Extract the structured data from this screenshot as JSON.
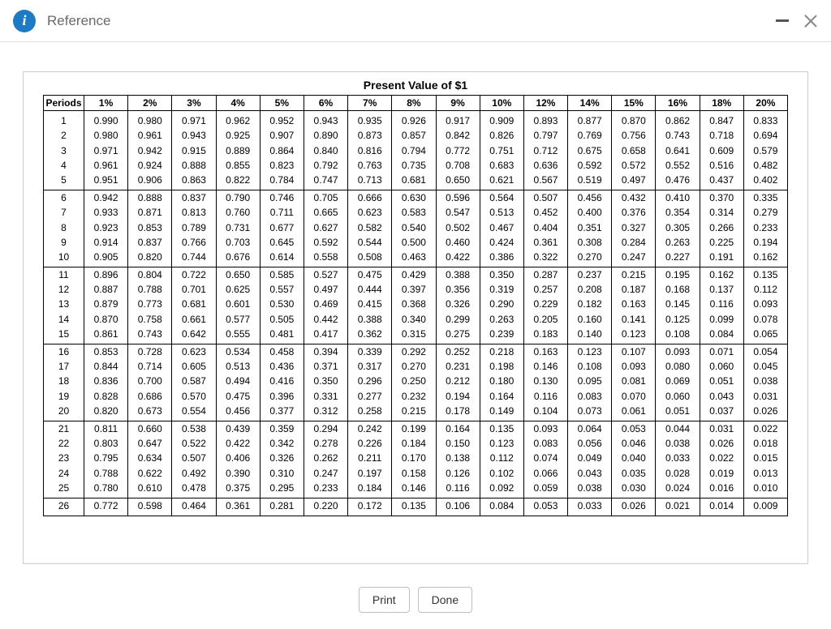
{
  "window": {
    "title": "Reference"
  },
  "buttons": {
    "print": "Print",
    "done": "Done"
  },
  "chart_data": {
    "type": "table",
    "title": "Present Value of $1",
    "periods_header": "Periods",
    "rates": [
      "1%",
      "2%",
      "3%",
      "4%",
      "5%",
      "6%",
      "7%",
      "8%",
      "9%",
      "10%",
      "12%",
      "14%",
      "15%",
      "16%",
      "18%",
      "20%"
    ],
    "group_sizes": [
      5,
      5,
      5,
      5,
      5,
      1
    ],
    "rows": [
      {
        "period": 1,
        "v": [
          0.99,
          0.98,
          0.971,
          0.962,
          0.952,
          0.943,
          0.935,
          0.926,
          0.917,
          0.909,
          0.893,
          0.877,
          0.87,
          0.862,
          0.847,
          0.833
        ]
      },
      {
        "period": 2,
        "v": [
          0.98,
          0.961,
          0.943,
          0.925,
          0.907,
          0.89,
          0.873,
          0.857,
          0.842,
          0.826,
          0.797,
          0.769,
          0.756,
          0.743,
          0.718,
          0.694
        ]
      },
      {
        "period": 3,
        "v": [
          0.971,
          0.942,
          0.915,
          0.889,
          0.864,
          0.84,
          0.816,
          0.794,
          0.772,
          0.751,
          0.712,
          0.675,
          0.658,
          0.641,
          0.609,
          0.579
        ]
      },
      {
        "period": 4,
        "v": [
          0.961,
          0.924,
          0.888,
          0.855,
          0.823,
          0.792,
          0.763,
          0.735,
          0.708,
          0.683,
          0.636,
          0.592,
          0.572,
          0.552,
          0.516,
          0.482
        ]
      },
      {
        "period": 5,
        "v": [
          0.951,
          0.906,
          0.863,
          0.822,
          0.784,
          0.747,
          0.713,
          0.681,
          0.65,
          0.621,
          0.567,
          0.519,
          0.497,
          0.476,
          0.437,
          0.402
        ]
      },
      {
        "period": 6,
        "v": [
          0.942,
          0.888,
          0.837,
          0.79,
          0.746,
          0.705,
          0.666,
          0.63,
          0.596,
          0.564,
          0.507,
          0.456,
          0.432,
          0.41,
          0.37,
          0.335
        ]
      },
      {
        "period": 7,
        "v": [
          0.933,
          0.871,
          0.813,
          0.76,
          0.711,
          0.665,
          0.623,
          0.583,
          0.547,
          0.513,
          0.452,
          0.4,
          0.376,
          0.354,
          0.314,
          0.279
        ]
      },
      {
        "period": 8,
        "v": [
          0.923,
          0.853,
          0.789,
          0.731,
          0.677,
          0.627,
          0.582,
          0.54,
          0.502,
          0.467,
          0.404,
          0.351,
          0.327,
          0.305,
          0.266,
          0.233
        ]
      },
      {
        "period": 9,
        "v": [
          0.914,
          0.837,
          0.766,
          0.703,
          0.645,
          0.592,
          0.544,
          0.5,
          0.46,
          0.424,
          0.361,
          0.308,
          0.284,
          0.263,
          0.225,
          0.194
        ]
      },
      {
        "period": 10,
        "v": [
          0.905,
          0.82,
          0.744,
          0.676,
          0.614,
          0.558,
          0.508,
          0.463,
          0.422,
          0.386,
          0.322,
          0.27,
          0.247,
          0.227,
          0.191,
          0.162
        ]
      },
      {
        "period": 11,
        "v": [
          0.896,
          0.804,
          0.722,
          0.65,
          0.585,
          0.527,
          0.475,
          0.429,
          0.388,
          0.35,
          0.287,
          0.237,
          0.215,
          0.195,
          0.162,
          0.135
        ]
      },
      {
        "period": 12,
        "v": [
          0.887,
          0.788,
          0.701,
          0.625,
          0.557,
          0.497,
          0.444,
          0.397,
          0.356,
          0.319,
          0.257,
          0.208,
          0.187,
          0.168,
          0.137,
          0.112
        ]
      },
      {
        "period": 13,
        "v": [
          0.879,
          0.773,
          0.681,
          0.601,
          0.53,
          0.469,
          0.415,
          0.368,
          0.326,
          0.29,
          0.229,
          0.182,
          0.163,
          0.145,
          0.116,
          0.093
        ]
      },
      {
        "period": 14,
        "v": [
          0.87,
          0.758,
          0.661,
          0.577,
          0.505,
          0.442,
          0.388,
          0.34,
          0.299,
          0.263,
          0.205,
          0.16,
          0.141,
          0.125,
          0.099,
          0.078
        ]
      },
      {
        "period": 15,
        "v": [
          0.861,
          0.743,
          0.642,
          0.555,
          0.481,
          0.417,
          0.362,
          0.315,
          0.275,
          0.239,
          0.183,
          0.14,
          0.123,
          0.108,
          0.084,
          0.065
        ]
      },
      {
        "period": 16,
        "v": [
          0.853,
          0.728,
          0.623,
          0.534,
          0.458,
          0.394,
          0.339,
          0.292,
          0.252,
          0.218,
          0.163,
          0.123,
          0.107,
          0.093,
          0.071,
          0.054
        ]
      },
      {
        "period": 17,
        "v": [
          0.844,
          0.714,
          0.605,
          0.513,
          0.436,
          0.371,
          0.317,
          0.27,
          0.231,
          0.198,
          0.146,
          0.108,
          0.093,
          0.08,
          0.06,
          0.045
        ]
      },
      {
        "period": 18,
        "v": [
          0.836,
          0.7,
          0.587,
          0.494,
          0.416,
          0.35,
          0.296,
          0.25,
          0.212,
          0.18,
          0.13,
          0.095,
          0.081,
          0.069,
          0.051,
          0.038
        ]
      },
      {
        "period": 19,
        "v": [
          0.828,
          0.686,
          0.57,
          0.475,
          0.396,
          0.331,
          0.277,
          0.232,
          0.194,
          0.164,
          0.116,
          0.083,
          0.07,
          0.06,
          0.043,
          0.031
        ]
      },
      {
        "period": 20,
        "v": [
          0.82,
          0.673,
          0.554,
          0.456,
          0.377,
          0.312,
          0.258,
          0.215,
          0.178,
          0.149,
          0.104,
          0.073,
          0.061,
          0.051,
          0.037,
          0.026
        ]
      },
      {
        "period": 21,
        "v": [
          0.811,
          0.66,
          0.538,
          0.439,
          0.359,
          0.294,
          0.242,
          0.199,
          0.164,
          0.135,
          0.093,
          0.064,
          0.053,
          0.044,
          0.031,
          0.022
        ]
      },
      {
        "period": 22,
        "v": [
          0.803,
          0.647,
          0.522,
          0.422,
          0.342,
          0.278,
          0.226,
          0.184,
          0.15,
          0.123,
          0.083,
          0.056,
          0.046,
          0.038,
          0.026,
          0.018
        ]
      },
      {
        "period": 23,
        "v": [
          0.795,
          0.634,
          0.507,
          0.406,
          0.326,
          0.262,
          0.211,
          0.17,
          0.138,
          0.112,
          0.074,
          0.049,
          0.04,
          0.033,
          0.022,
          0.015
        ]
      },
      {
        "period": 24,
        "v": [
          0.788,
          0.622,
          0.492,
          0.39,
          0.31,
          0.247,
          0.197,
          0.158,
          0.126,
          0.102,
          0.066,
          0.043,
          0.035,
          0.028,
          0.019,
          0.013
        ]
      },
      {
        "period": 25,
        "v": [
          0.78,
          0.61,
          0.478,
          0.375,
          0.295,
          0.233,
          0.184,
          0.146,
          0.116,
          0.092,
          0.059,
          0.038,
          0.03,
          0.024,
          0.016,
          0.01
        ]
      },
      {
        "period": 26,
        "v": [
          0.772,
          0.598,
          0.464,
          0.361,
          0.281,
          0.22,
          0.172,
          0.135,
          0.106,
          0.084,
          0.053,
          0.033,
          0.026,
          0.021,
          0.014,
          0.009
        ]
      }
    ]
  }
}
